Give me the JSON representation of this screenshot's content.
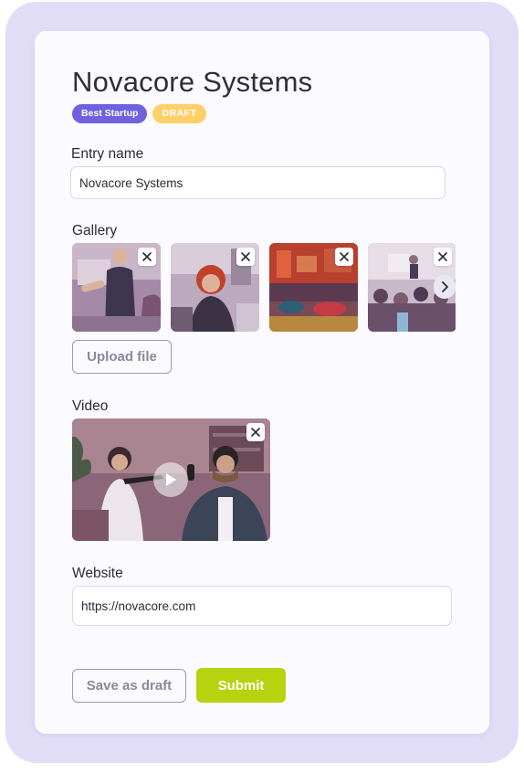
{
  "entry": {
    "title": "Novacore Systems",
    "badges": {
      "category": "Best Startup",
      "status": "DRAFT"
    }
  },
  "fields": {
    "entry_name": {
      "label": "Entry name",
      "value": "Novacore Systems"
    },
    "gallery": {
      "label": "Gallery",
      "photos": [
        {
          "subject": "presenter-at-whiteboard"
        },
        {
          "subject": "smiling-woman-in-office"
        },
        {
          "subject": "colorful-lounge-workspace"
        },
        {
          "subject": "audience-at-presentation"
        }
      ],
      "upload_label": "Upload file"
    },
    "video": {
      "label": "Video",
      "subject": "podcast-interview"
    },
    "website": {
      "label": "Website",
      "value": "https://novacore.com"
    }
  },
  "actions": {
    "save_draft": "Save as draft",
    "submit": "Submit"
  },
  "colors": {
    "accent_purple": "#7061e0",
    "draft_yellow": "#ffcf6a",
    "submit_green": "#b5d30e",
    "frame_lavender": "#e2ddf7"
  }
}
